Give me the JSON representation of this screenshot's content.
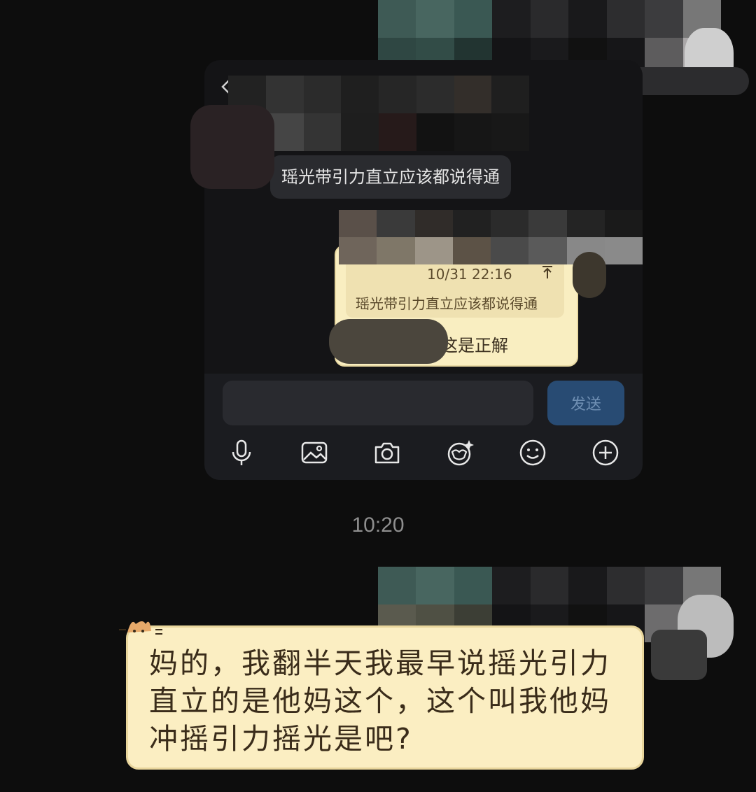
{
  "inner_chat": {
    "message_received": "瑶光带引力直立应该都说得通",
    "reply": {
      "quote_time": "10/31 22:16",
      "quote_text": "瑶光带引力直立应该都说得通",
      "text": "这是正解"
    },
    "input": {
      "placeholder": "",
      "send_label": "发送"
    },
    "toolbar": [
      "microphone-icon",
      "image-icon",
      "camera-icon",
      "sticker-icon",
      "emoji-icon",
      "add-icon"
    ]
  },
  "timestamp": "10:20",
  "message": {
    "text": "妈的，我翻半天我最早说摇光引力直立的是他妈这个，这个叫我他妈冲摇引力摇光是吧?"
  },
  "colors": {
    "background": "#0d0d0d",
    "bubble_yellow": "#fbeec2",
    "send_button": "#284b73"
  }
}
